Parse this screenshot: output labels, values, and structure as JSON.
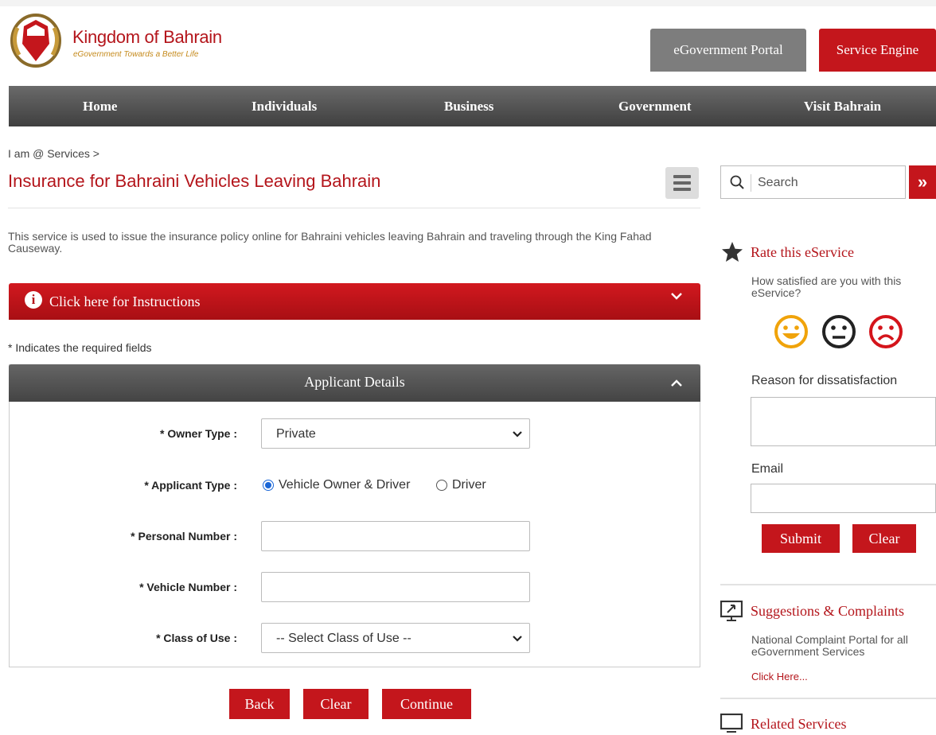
{
  "header": {
    "brand_title": "Kingdom of Bahrain",
    "brand_subtitle": "eGovernment Towards a Better Life",
    "portal_label": "eGovernment Portal",
    "engine_label": "Service Engine"
  },
  "nav": {
    "items": [
      "Home",
      "Individuals",
      "Business",
      "Government",
      "Visit Bahrain"
    ]
  },
  "page": {
    "breadcrumb": "I am @ Services >",
    "title": "Insurance for Bahraini Vehicles Leaving Bahrain",
    "description": "This service is used to issue the insurance policy online for Bahraini vehicles leaving Bahrain and traveling through the King Fahad Causeway.",
    "instructions_label": "Click here for Instructions",
    "required_note": "* Indicates the required fields"
  },
  "form": {
    "panel_title": "Applicant Details",
    "owner_type_label": "* Owner Type :",
    "owner_type_value": "Private",
    "applicant_type_label": "* Applicant Type :",
    "applicant_options": [
      "Vehicle Owner & Driver",
      "Driver"
    ],
    "applicant_selected": "Vehicle Owner & Driver",
    "personal_number_label": "* Personal Number :",
    "personal_number_value": "",
    "vehicle_number_label": "* Vehicle Number :",
    "vehicle_number_value": "",
    "class_of_use_label": "* Class of Use :",
    "class_of_use_value": "-- Select Class of Use --",
    "back_label": "Back",
    "clear_label": "Clear",
    "continue_label": "Continue"
  },
  "sidebar": {
    "search_placeholder": "Search",
    "search_go": "»",
    "rate_title": "Rate this eService",
    "rate_question": "How satisfied are you with this eService?",
    "faces": [
      "happy",
      "neutral",
      "sad"
    ],
    "reason_label": "Reason for dissatisfaction",
    "reason_value": "",
    "email_label": "Email",
    "email_value": "",
    "submit_label": "Submit",
    "clear_label": "Clear",
    "suggestions_title": "Suggestions & Complaints",
    "suggestions_text": "National Complaint Portal for all eGovernment Services",
    "suggestions_link": "Click Here...",
    "related_title": "Related Services"
  },
  "colors": {
    "brand_red": "#c4161c",
    "nav_dark": "#4a4a4a",
    "portal_grey": "#7d7d7d",
    "happy_face": "#f0a30a",
    "sad_face": "#d4141b"
  }
}
